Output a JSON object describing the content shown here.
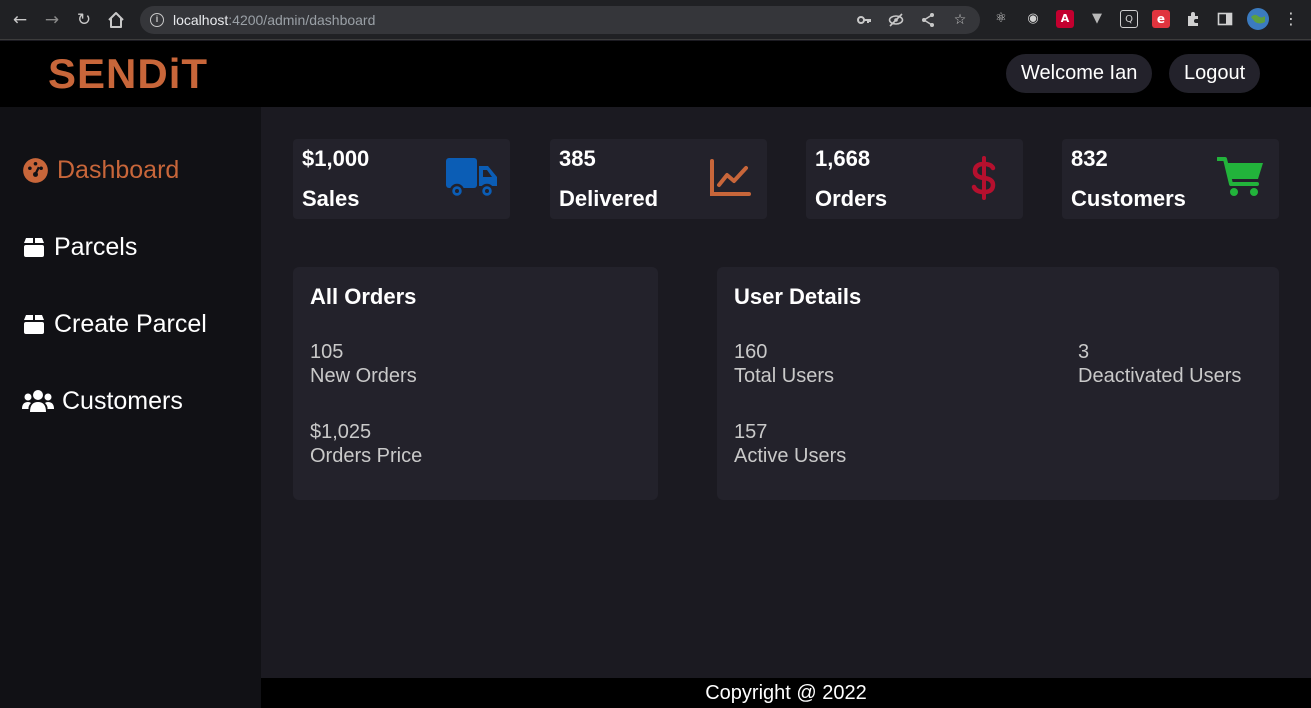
{
  "browser": {
    "url_host": "localhost",
    "url_rest": ":4200/admin/dashboard"
  },
  "header": {
    "logo": "SENDiT",
    "welcome": "Welcome Ian",
    "logout": "Logout"
  },
  "sidebar": {
    "items": [
      {
        "label": "Dashboard",
        "icon": "dashboard-icon",
        "active": true
      },
      {
        "label": "Parcels",
        "icon": "box-icon"
      },
      {
        "label": "Create Parcel",
        "icon": "box-icon"
      },
      {
        "label": "Customers",
        "icon": "users-icon"
      }
    ]
  },
  "stats": [
    {
      "value": "$1,000",
      "label": "Sales",
      "icon": "truck-icon",
      "color": "#0b5db5"
    },
    {
      "value": "385",
      "label": "Delivered",
      "icon": "chart-line-icon",
      "color": "#c8663a"
    },
    {
      "value": "1,668",
      "label": "Orders",
      "icon": "dollar-icon",
      "color": "#b5102e"
    },
    {
      "value": "832",
      "label": "Customers",
      "icon": "cart-icon",
      "color": "#22b33b"
    }
  ],
  "all_orders": {
    "title": "All Orders",
    "new_orders_value": "105",
    "new_orders_label": "New Orders",
    "price_value": "$1,025",
    "price_label": "Orders Price"
  },
  "user_details": {
    "title": "User Details",
    "total_value": "160",
    "total_label": "Total Users",
    "deactivated_value": "3",
    "deactivated_label": "Deactivated Users",
    "active_value": "157",
    "active_label": "Active Users"
  },
  "footer": {
    "text": "Copyright @ 2022"
  },
  "colors": {
    "accent": "#c8663a",
    "background": "#1b1a21",
    "card": "#23222b",
    "sidebar": "#111115"
  }
}
